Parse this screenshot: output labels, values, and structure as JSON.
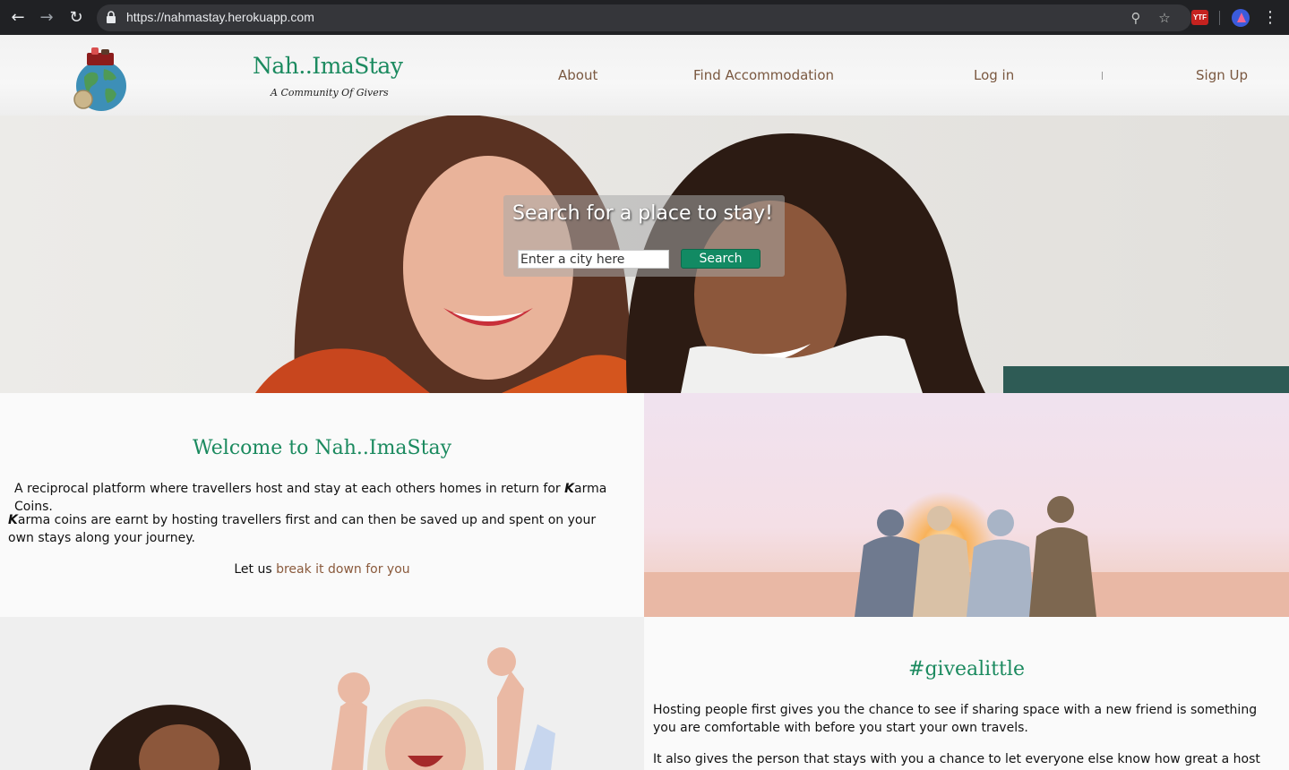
{
  "browser": {
    "url": "https://nahmastay.herokuapp.com"
  },
  "header": {
    "brand_title": "Nah..ImaStay",
    "brand_tagline": "A Community Of Givers",
    "nav": {
      "about": "About",
      "find": "Find Accommodation",
      "login": "Log in",
      "signup": "Sign Up"
    }
  },
  "hero": {
    "search_title": "Search for a place to stay!",
    "search_placeholder": "Enter a city here",
    "search_button": "Search"
  },
  "welcome": {
    "heading": "Welcome to Nah..ImaStay",
    "p1_text": "A reciprocal platform where travellers host and stay at each others homes in return for ",
    "p1_coin": "K",
    "p1_text_end": "arma Coins.",
    "p2_coin": "K",
    "p2_text": "arma coins are earnt by hosting travellers first and can then be saved up and spent on your own stays along your journey.",
    "p3_text": "Let us ",
    "p3_link": "break it down for you"
  },
  "givelittle": {
    "heading": "#givealittle",
    "g1": "Hosting people first gives you the chance to see if sharing space with a new friend is something you are comfortable with before you start your own travels.",
    "g2": "It also gives the person that stays with you a chance to let everyone else know how great a host you"
  },
  "colors": {
    "brand_green": "#1b8a5f",
    "nav_brown": "#7a5840",
    "button_green": "#128a63"
  }
}
